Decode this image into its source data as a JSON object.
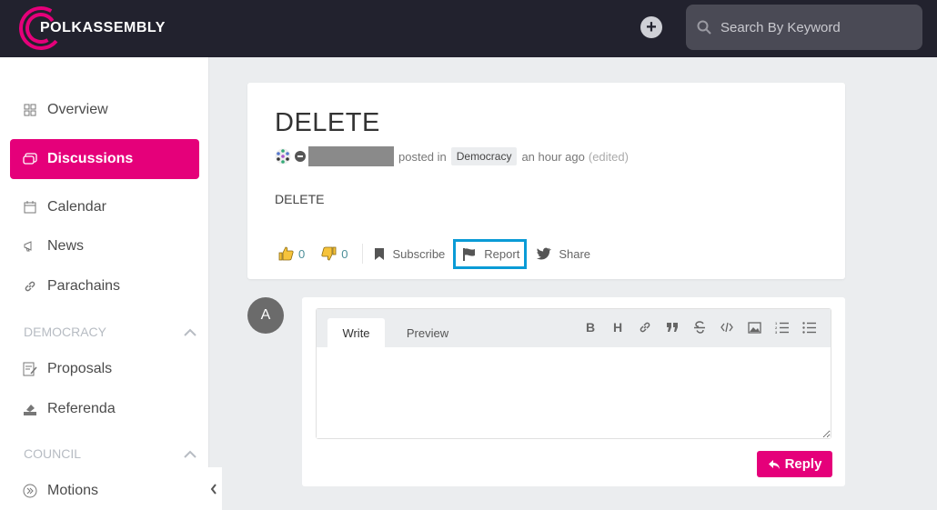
{
  "brand": {
    "name": "POLKASSEMBLY",
    "accent": "#e5007a"
  },
  "header": {
    "search_placeholder": "Search By Keyword"
  },
  "sidebar": {
    "items": [
      {
        "label": "Overview",
        "icon": "grid-icon"
      },
      {
        "label": "Discussions",
        "icon": "chat-icon",
        "active": true
      },
      {
        "label": "Calendar",
        "icon": "calendar-icon"
      },
      {
        "label": "News",
        "icon": "megaphone-icon"
      },
      {
        "label": "Parachains",
        "icon": "link-icon"
      }
    ],
    "democracy": {
      "title": "DEMOCRACY",
      "items": [
        {
          "label": "Proposals"
        },
        {
          "label": "Referenda"
        }
      ]
    },
    "council": {
      "title": "COUNCIL",
      "items": [
        {
          "label": "Motions"
        }
      ]
    }
  },
  "post": {
    "title": "DELETE",
    "posted_in": "posted in",
    "topic": "Democracy",
    "time": "an hour ago",
    "edited": "(edited)",
    "body": "DELETE",
    "likes": "0",
    "dislikes": "0",
    "subscribe": "Subscribe",
    "report": "Report",
    "share": "Share"
  },
  "comment": {
    "avatar_letter": "A",
    "tab_write": "Write",
    "tab_preview": "Preview",
    "reply": "Reply"
  }
}
